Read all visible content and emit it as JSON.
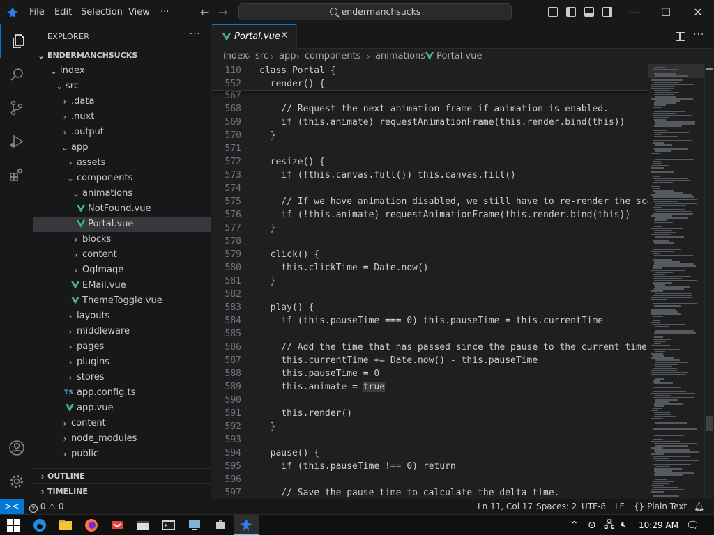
{
  "titlebar": {
    "menus": [
      "File",
      "Edit",
      "Selection",
      "View"
    ],
    "more": "···",
    "search": "endermanchsucks",
    "back": "←",
    "forward": "→",
    "minimize": "—",
    "maximize": "☐",
    "close": "✕"
  },
  "explorer": {
    "title": "EXPLORER",
    "more": "···",
    "root": "ENDERMANCHSUCKS",
    "tree": [
      {
        "label": "index",
        "depth": 1,
        "kind": "folder-open"
      },
      {
        "label": "src",
        "depth": 2,
        "kind": "folder-open"
      },
      {
        "label": ".data",
        "depth": 3,
        "kind": "folder"
      },
      {
        "label": ".nuxt",
        "depth": 3,
        "kind": "folder"
      },
      {
        "label": ".output",
        "depth": 3,
        "kind": "folder"
      },
      {
        "label": "app",
        "depth": 3,
        "kind": "folder-open"
      },
      {
        "label": "assets",
        "depth": 4,
        "kind": "folder"
      },
      {
        "label": "components",
        "depth": 4,
        "kind": "folder-open"
      },
      {
        "label": "animations",
        "depth": 5,
        "kind": "folder-open"
      },
      {
        "label": "NotFound.vue",
        "depth": 6,
        "kind": "vue"
      },
      {
        "label": "Portal.vue",
        "depth": 6,
        "kind": "vue",
        "selected": true
      },
      {
        "label": "blocks",
        "depth": 5,
        "kind": "folder"
      },
      {
        "label": "content",
        "depth": 5,
        "kind": "folder"
      },
      {
        "label": "OgImage",
        "depth": 5,
        "kind": "folder"
      },
      {
        "label": "EMail.vue",
        "depth": 5,
        "kind": "vue"
      },
      {
        "label": "ThemeToggle.vue",
        "depth": 5,
        "kind": "vue"
      },
      {
        "label": "layouts",
        "depth": 4,
        "kind": "folder"
      },
      {
        "label": "middleware",
        "depth": 4,
        "kind": "folder"
      },
      {
        "label": "pages",
        "depth": 4,
        "kind": "folder"
      },
      {
        "label": "plugins",
        "depth": 4,
        "kind": "folder"
      },
      {
        "label": "stores",
        "depth": 4,
        "kind": "folder"
      },
      {
        "label": "app.config.ts",
        "depth": 4,
        "kind": "ts"
      },
      {
        "label": "app.vue",
        "depth": 4,
        "kind": "vue"
      },
      {
        "label": "content",
        "depth": 3,
        "kind": "folder"
      },
      {
        "label": "node_modules",
        "depth": 3,
        "kind": "folder"
      },
      {
        "label": "public",
        "depth": 3,
        "kind": "folder"
      }
    ],
    "outline": "OUTLINE",
    "timeline": "TIMELINE"
  },
  "tab": {
    "label": "Portal.vue",
    "close": "✕",
    "more": "···"
  },
  "breadcrumb": [
    "index",
    "src",
    "app",
    "components",
    "animations",
    "Portal.vue"
  ],
  "breadcrumb_sep": "›",
  "sticky": [
    {
      "n": "110",
      "text": "class Portal {"
    },
    {
      "n": "552",
      "text": "  render() {"
    }
  ],
  "code": [
    {
      "n": "567",
      "text": ""
    },
    {
      "n": "568",
      "text": "    // Request the next animation frame if animation is enabled."
    },
    {
      "n": "569",
      "text": "    if (this.animate) requestAnimationFrame(this.render.bind(this))"
    },
    {
      "n": "570",
      "text": "  }"
    },
    {
      "n": "571",
      "text": ""
    },
    {
      "n": "572",
      "text": "  resize() {"
    },
    {
      "n": "573",
      "text": "    if (!this.canvas.full()) this.canvas.fill()"
    },
    {
      "n": "574",
      "text": ""
    },
    {
      "n": "575",
      "text": "    // If we have animation disabled, we still have to re-render the scene"
    },
    {
      "n": "576",
      "text": "    if (!this.animate) requestAnimationFrame(this.render.bind(this))"
    },
    {
      "n": "577",
      "text": "  }"
    },
    {
      "n": "578",
      "text": ""
    },
    {
      "n": "579",
      "text": "  click() {"
    },
    {
      "n": "580",
      "text": "    this.clickTime = Date.now()"
    },
    {
      "n": "581",
      "text": "  }"
    },
    {
      "n": "582",
      "text": ""
    },
    {
      "n": "583",
      "text": "  play() {"
    },
    {
      "n": "584",
      "text": "    if (this.pauseTime === 0) this.pauseTime = this.currentTime"
    },
    {
      "n": "585",
      "text": ""
    },
    {
      "n": "586",
      "text": "    // Add the time that has passed since the pause to the current time."
    },
    {
      "n": "587",
      "text": "    this.currentTime += Date.now() - this.pauseTime"
    },
    {
      "n": "588",
      "text": "    this.pauseTime = 0"
    },
    {
      "n": "589",
      "text": "    this.animate = true",
      "highlight": "true"
    },
    {
      "n": "590",
      "text": ""
    },
    {
      "n": "591",
      "text": "    this.render()"
    },
    {
      "n": "592",
      "text": "  }"
    },
    {
      "n": "593",
      "text": ""
    },
    {
      "n": "594",
      "text": "  pause() {"
    },
    {
      "n": "595",
      "text": "    if (this.pauseTime !== 0) return"
    },
    {
      "n": "596",
      "text": ""
    },
    {
      "n": "597",
      "text": "    // Save the pause time to calculate the delta time."
    }
  ],
  "status": {
    "remote": "><",
    "errors": "0",
    "warnings": "0",
    "position": "Ln 11, Col 17",
    "spaces": "Spaces: 2",
    "encoding": "UTF-8",
    "eol": "LF",
    "language": "Plain Text",
    "lang_braces": "{}"
  },
  "taskbar": {
    "time": "10:29 AM"
  },
  "colors": {
    "accent": "#0078d4",
    "vue": "#41b883",
    "ts": "#519aba"
  }
}
